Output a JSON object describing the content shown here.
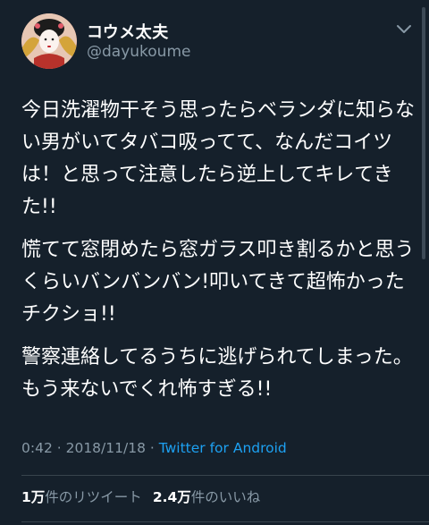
{
  "user": {
    "display_name": "コウメ太夫",
    "handle": "@dayukoume"
  },
  "tweet": {
    "paragraphs": [
      "今日洗濯物干そう思ったらベランダに知らない男がいてタバコ吸ってて、なんだコイツは！と思って注意したら逆上してキレてきた!!",
      "慌てて窓閉めたら窓ガラス叩き割るかと思うくらいバンバンバン!叩いてきて超怖かったチクショ!!",
      "警察連絡してるうちに逃げられてしまった。もう来ないでくれ怖すぎる!!"
    ],
    "time": "0:42",
    "separator1": " · ",
    "date": "2018/11/18",
    "separator2": " · ",
    "source": "Twitter for Android"
  },
  "stats": {
    "retweets_count": "1万",
    "retweets_label": "件のリツイート",
    "likes_count": "2.4万",
    "likes_label": "件のいいね"
  },
  "icons": {
    "more": "chevron-down-icon",
    "avatar": "avatar-image"
  },
  "colors": {
    "background": "#15202b",
    "text": "#ffffff",
    "secondary": "#8899a6",
    "link": "#1da1f2",
    "divider": "#38444d"
  }
}
